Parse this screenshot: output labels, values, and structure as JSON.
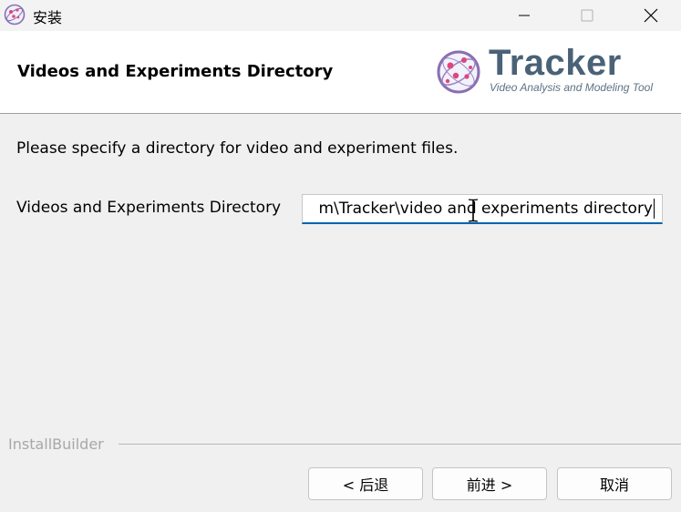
{
  "window": {
    "title": "安装",
    "icons": {
      "app": "tracker-app-icon",
      "minimize": "minimize-icon",
      "maximize": "maximize-icon",
      "close": "close-icon"
    }
  },
  "header": {
    "title": "Videos and Experiments Directory",
    "logo": {
      "name": "Tracker",
      "tagline": "Video Analysis and Modeling Tool",
      "colors": {
        "wordmark": "#4a6277",
        "orbit": "#8a6fb0",
        "dots": "#e0457b"
      }
    }
  },
  "body": {
    "instruction": "Please specify a directory for video and experiment files.",
    "directory_label": "Videos and Experiments Directory",
    "directory_value": "m\\Tracker\\video and experiments directory"
  },
  "footer": {
    "brand": "InstallBuilder",
    "buttons": {
      "back": "< 后退",
      "next": "前进 >",
      "cancel": "取消"
    }
  },
  "colors": {
    "accent": "#0063b1",
    "background": "#f0f0f0",
    "header_background": "#ffffff"
  }
}
